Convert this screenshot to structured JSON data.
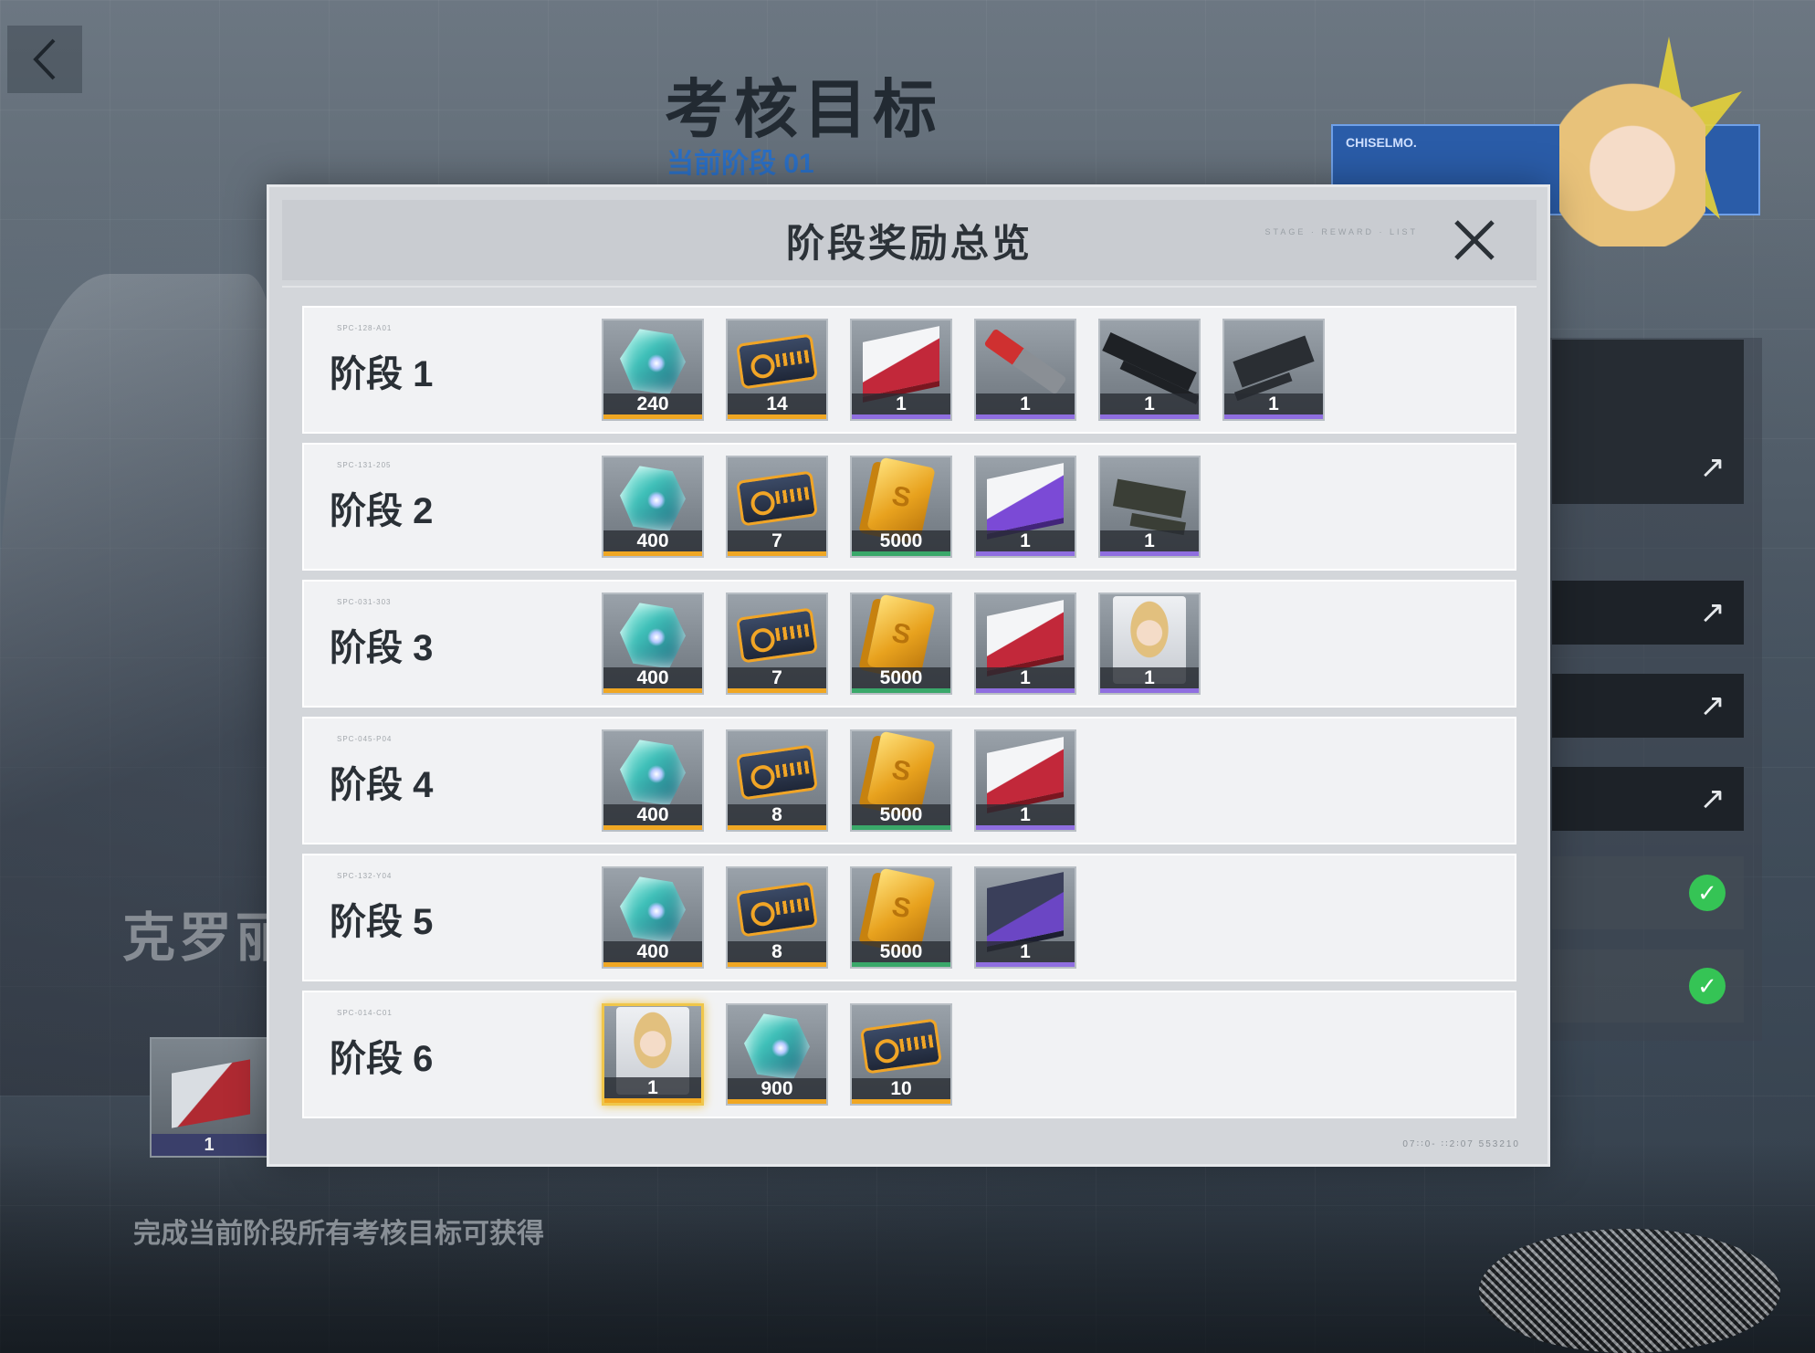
{
  "background": {
    "page_title": "考核目标",
    "page_subtitle": "当前阶段 01",
    "character_name": "克罗丽",
    "banner_text": "CHISELMO.",
    "hint_text": "完成当前阶段所有考核目标可获得",
    "reward_preview_count": "1"
  },
  "modal": {
    "title": "阶段奖励总览",
    "header_deco": "STAGE · REWARD · LIST",
    "footer_deco": "07∶∶0- ∶∶2∶07 553210",
    "stages": [
      {
        "label": "阶段 1",
        "tiny": "SPC-128-A01",
        "items": [
          {
            "icon": "gem-icon",
            "count": "240",
            "rarity": "gold"
          },
          {
            "icon": "ticket-icon",
            "count": "14",
            "rarity": "gold"
          },
          {
            "icon": "supply-box-red-icon",
            "count": "1",
            "rarity": "purple"
          },
          {
            "icon": "knife-icon",
            "count": "1",
            "rarity": "purple"
          },
          {
            "icon": "rifle-icon",
            "count": "1",
            "rarity": "purple"
          },
          {
            "icon": "smg-icon",
            "count": "1",
            "rarity": "purple"
          }
        ]
      },
      {
        "label": "阶段 2",
        "tiny": "SPC-131-205",
        "items": [
          {
            "icon": "gem-icon",
            "count": "400",
            "rarity": "gold"
          },
          {
            "icon": "ticket-icon",
            "count": "7",
            "rarity": "gold"
          },
          {
            "icon": "gold-bar-icon",
            "count": "5000",
            "rarity": "green"
          },
          {
            "icon": "supply-box-purple-icon",
            "count": "1",
            "rarity": "purple"
          },
          {
            "icon": "pistol-icon",
            "count": "1",
            "rarity": "purple"
          }
        ]
      },
      {
        "label": "阶段 3",
        "tiny": "SPC-031-303",
        "items": [
          {
            "icon": "gem-icon",
            "count": "400",
            "rarity": "gold"
          },
          {
            "icon": "ticket-icon",
            "count": "7",
            "rarity": "gold"
          },
          {
            "icon": "gold-bar-icon",
            "count": "5000",
            "rarity": "green"
          },
          {
            "icon": "supply-box-red-icon",
            "count": "1",
            "rarity": "purple"
          },
          {
            "icon": "portrait-icon",
            "count": "1",
            "rarity": "purple"
          }
        ]
      },
      {
        "label": "阶段 4",
        "tiny": "SPC-045-P04",
        "items": [
          {
            "icon": "gem-icon",
            "count": "400",
            "rarity": "gold"
          },
          {
            "icon": "ticket-icon",
            "count": "8",
            "rarity": "gold"
          },
          {
            "icon": "gold-bar-icon",
            "count": "5000",
            "rarity": "green"
          },
          {
            "icon": "supply-box-red-icon",
            "count": "1",
            "rarity": "purple"
          }
        ]
      },
      {
        "label": "阶段 5",
        "tiny": "SPC-132-Y04",
        "items": [
          {
            "icon": "gem-icon",
            "count": "400",
            "rarity": "gold"
          },
          {
            "icon": "ticket-icon",
            "count": "8",
            "rarity": "gold"
          },
          {
            "icon": "gold-bar-icon",
            "count": "5000",
            "rarity": "green"
          },
          {
            "icon": "supply-box-dark-icon",
            "count": "1",
            "rarity": "purple"
          }
        ]
      },
      {
        "label": "阶段 6",
        "tiny": "SPC-014-C01",
        "items": [
          {
            "icon": "portrait-icon",
            "count": "1",
            "rarity": "gold",
            "highlight": true
          },
          {
            "icon": "gem-icon",
            "count": "900",
            "rarity": "gold"
          },
          {
            "icon": "ticket-icon",
            "count": "10",
            "rarity": "gold"
          }
        ]
      }
    ]
  },
  "colors": {
    "rarity_gold": "#f0a723",
    "rarity_purple": "#8f6ee0",
    "rarity_green": "#3aa86a",
    "accent_blue": "#2b6fc4",
    "check_green": "#35c455"
  }
}
